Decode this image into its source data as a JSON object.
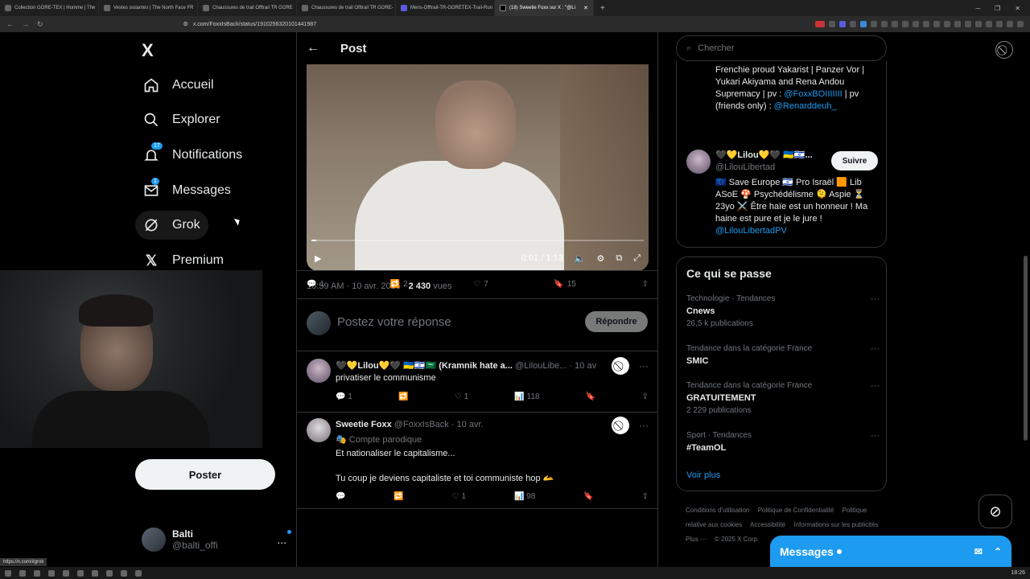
{
  "browser": {
    "tabs": [
      {
        "title": "Collection GORE-TEX | Homme | The"
      },
      {
        "title": "Vestes isolantes | The North Face FR"
      },
      {
        "title": "Chaussures de trail Offtrail TR GORE"
      },
      {
        "title": "Chaussures de trail Offtrail TR GORE-"
      },
      {
        "title": "Mens-Offtrail-TR-GORETEX-Trail-Run"
      },
      {
        "title": "(18) Sweetie Foxx sur X : \"@Li",
        "active": true
      }
    ],
    "new_tab": "+",
    "url": "x.com/FoxxIsBack/status/1910256320101441987"
  },
  "sidebar": {
    "logo": "X",
    "items": [
      {
        "label": "Accueil",
        "icon": "home-icon"
      },
      {
        "label": "Explorer",
        "icon": "search-icon"
      },
      {
        "label": "Notifications",
        "icon": "bell-icon",
        "badge": "17"
      },
      {
        "label": "Messages",
        "icon": "envelope-icon",
        "badge": "1"
      },
      {
        "label": "Grok",
        "icon": "grok-icon"
      },
      {
        "label": "Premium",
        "icon": "x-icon"
      }
    ],
    "post_button": "Poster",
    "account": {
      "name": "Balti",
      "handle": "@balti_offi",
      "more": "..."
    }
  },
  "main": {
    "header_title": "Post",
    "video": {
      "current": "0:01",
      "separator": "/",
      "duration": "1:13",
      "progress": 0.014
    },
    "meta": {
      "time": "10:59 AM",
      "date": "10 avr. 2025",
      "views": "2 430",
      "views_label": "vues"
    },
    "actions": {
      "replies": "1",
      "reposts": "2",
      "likes": "7",
      "bookmarks": "15"
    },
    "reply_placeholder": "Postez votre réponse",
    "reply_button": "Répondre",
    "replies": [
      {
        "name": "🖤💛Lilou💛🖤 🇺🇦🇮🇱🇸🇦 (Kramnik hate a...",
        "handle": "@LilouLibe...",
        "date": "· 10 av",
        "text": "privatiser le communisme",
        "replies": "1",
        "reposts": "",
        "likes": "1",
        "views": "118"
      },
      {
        "name": "Sweetie Foxx",
        "handle": "@FoxxIsBack",
        "date": "· 10 avr.",
        "badge": "🎭 Compte parodique",
        "text1": "Et nationaliser le capitalisme...",
        "text2": "Tu coup je deviens capitaliste et toi communiste hop 🫴",
        "replies": "",
        "reposts": "",
        "likes": "1",
        "views": "98"
      }
    ]
  },
  "right": {
    "search_placeholder": "Chercher",
    "bio1": [
      "Frenchie proud Yakarist | Panzer Vor |",
      "Yukari Akiyama and Rena Andou",
      "Supremacy | pv : ",
      "@FoxxBOIIIIIII",
      " | pv",
      "(friends only) : ",
      "@Renarddeuh_"
    ],
    "follow": {
      "name": "🖤💛Lilou💛🖤 🇺🇦🇮🇱...",
      "handle": "@LilouLibertad",
      "button": "Suivre",
      "bio": [
        "🇪🇺 Save Europe 🇮🇱 Pro Israël 🟧 Lib",
        "ASoE 🍄 Psychédélisme 🫠 Aspie ⏳",
        "23yo ⚔️ Être haïe est un honneur ! Ma",
        "haine est pure et je le jure !"
      ],
      "link": "@LilouLibertadPV"
    },
    "trends_title": "Ce qui se passe",
    "trends": [
      {
        "category": "Technologie · Tendances",
        "title": "Cnews",
        "count": "26,5 k publications"
      },
      {
        "category": "Tendance dans la catégorie France",
        "title": "SMIC",
        "count": ""
      },
      {
        "category": "Tendance dans la catégorie France",
        "title": "GRATUITEMENT",
        "count": "2 229 publications"
      },
      {
        "category": "Sport · Tendances",
        "title": "#TeamOL",
        "count": ""
      }
    ],
    "more": "Voir plus",
    "footer": [
      "Conditions d'utilisation",
      "Politique de Confidentialité",
      "Politique relative aux cookies",
      "Accessibilité",
      "Informations sur les publicités",
      "Plus ···",
      "© 2025 X Corp."
    ]
  },
  "messages_drawer": {
    "label": "Messages"
  },
  "status_url": "https://x.com/i/grok",
  "taskbar": {
    "time": "18:26"
  },
  "colors": {
    "accent": "#1d9bf0",
    "background": "#000000",
    "border": "#2f3336",
    "muted": "#71767b"
  }
}
